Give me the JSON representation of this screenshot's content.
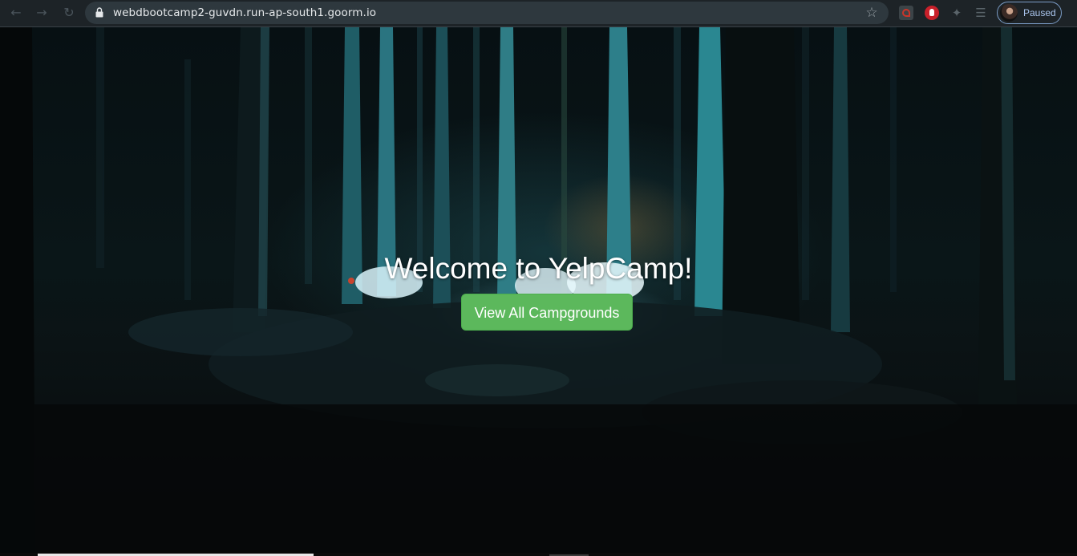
{
  "browser": {
    "url": "webdbootcamp2-guvdn.run-ap-south1.goorm.io",
    "profile_status": "Paused",
    "icons": {
      "back": "back-arrow-icon",
      "forward": "forward-arrow-icon",
      "reload": "reload-icon",
      "lock": "lock-icon",
      "bookmark": "star-icon",
      "extensions": [
        "pdf-extension-icon",
        "adblock-hand-icon",
        "puzzle-extensions-icon",
        "reading-list-icon"
      ]
    },
    "glyphs": {
      "back": "←",
      "forward": "→",
      "reload": "↻",
      "star": "☆",
      "puzzle": "✦",
      "queue": "☰"
    }
  },
  "page": {
    "title": "Welcome to YelpCamp!",
    "cta_label": "View All Campgrounds",
    "colors": {
      "cta_background": "#5cb85c",
      "cta_border": "#4cae4c"
    }
  }
}
